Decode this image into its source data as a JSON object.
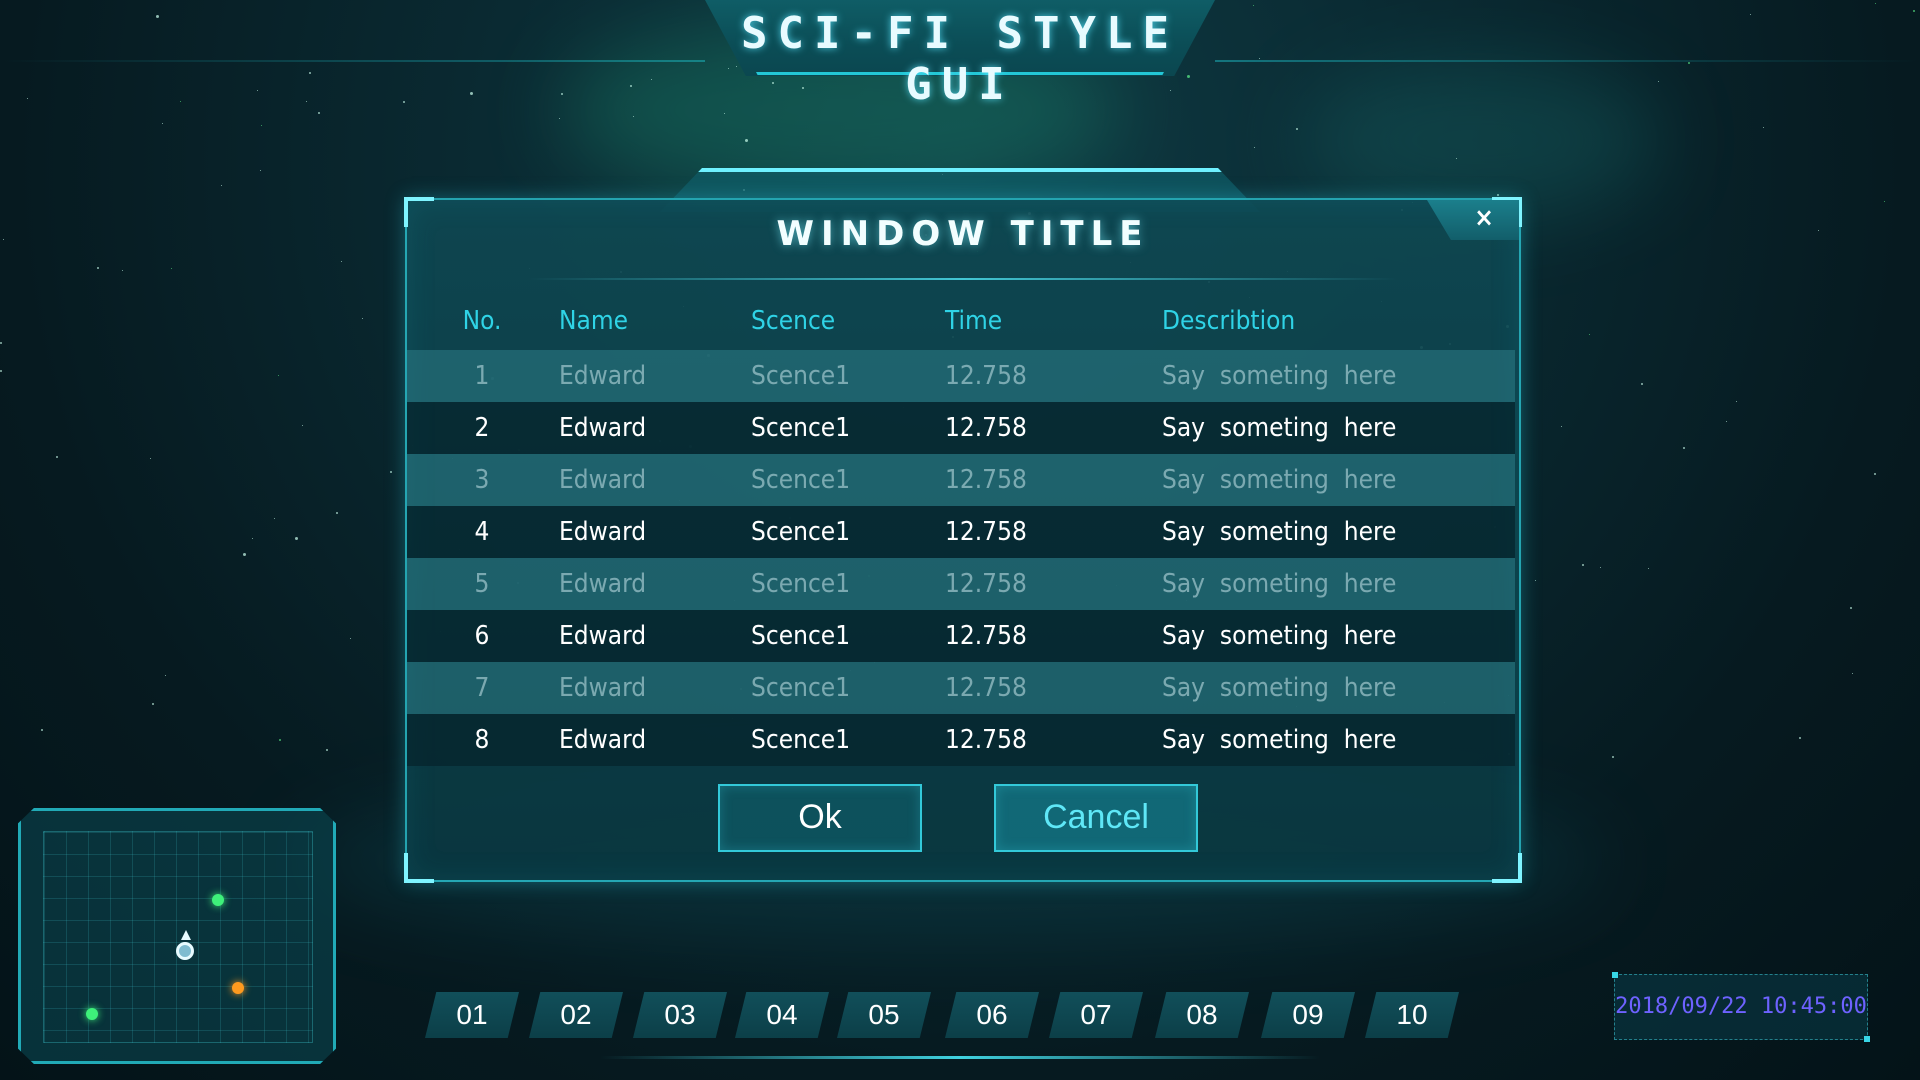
{
  "app": {
    "title": "SCI-FI STYLE GUI"
  },
  "dialog": {
    "title": "WINDOW TITLE",
    "close_label": "×",
    "columns": [
      "No.",
      "Name",
      "Scence",
      "Time",
      "Describtion"
    ],
    "rows": [
      [
        "1",
        "Edward",
        "Scence1",
        "12.758",
        "Say  someting  here"
      ],
      [
        "2",
        "Edward",
        "Scence1",
        "12.758",
        "Say  someting  here"
      ],
      [
        "3",
        "Edward",
        "Scence1",
        "12.758",
        "Say  someting  here"
      ],
      [
        "4",
        "Edward",
        "Scence1",
        "12.758",
        "Say  someting  here"
      ],
      [
        "5",
        "Edward",
        "Scence1",
        "12.758",
        "Say  someting  here"
      ],
      [
        "6",
        "Edward",
        "Scence1",
        "12.758",
        "Say  someting  here"
      ],
      [
        "7",
        "Edward",
        "Scence1",
        "12.758",
        "Say  someting  here"
      ],
      [
        "8",
        "Edward",
        "Scence1",
        "12.758",
        "Say  someting  here"
      ]
    ],
    "ok_label": "Ok",
    "cancel_label": "Cancel"
  },
  "radar": {
    "markers": [
      {
        "name": "green-dot",
        "color": "#3ef07a"
      },
      {
        "name": "orange-dot",
        "color": "#ff9a1f"
      },
      {
        "name": "green-dot",
        "color": "#3ef07a"
      }
    ]
  },
  "page_tabs": [
    "01",
    "02",
    "03",
    "04",
    "05",
    "06",
    "07",
    "08",
    "09",
    "10"
  ],
  "clock": {
    "text": "2018/09/22 10:45:00"
  },
  "colors": {
    "accent": "#2fd3e6",
    "frame": "#33c9d9",
    "clock_text": "#6e62ff"
  }
}
